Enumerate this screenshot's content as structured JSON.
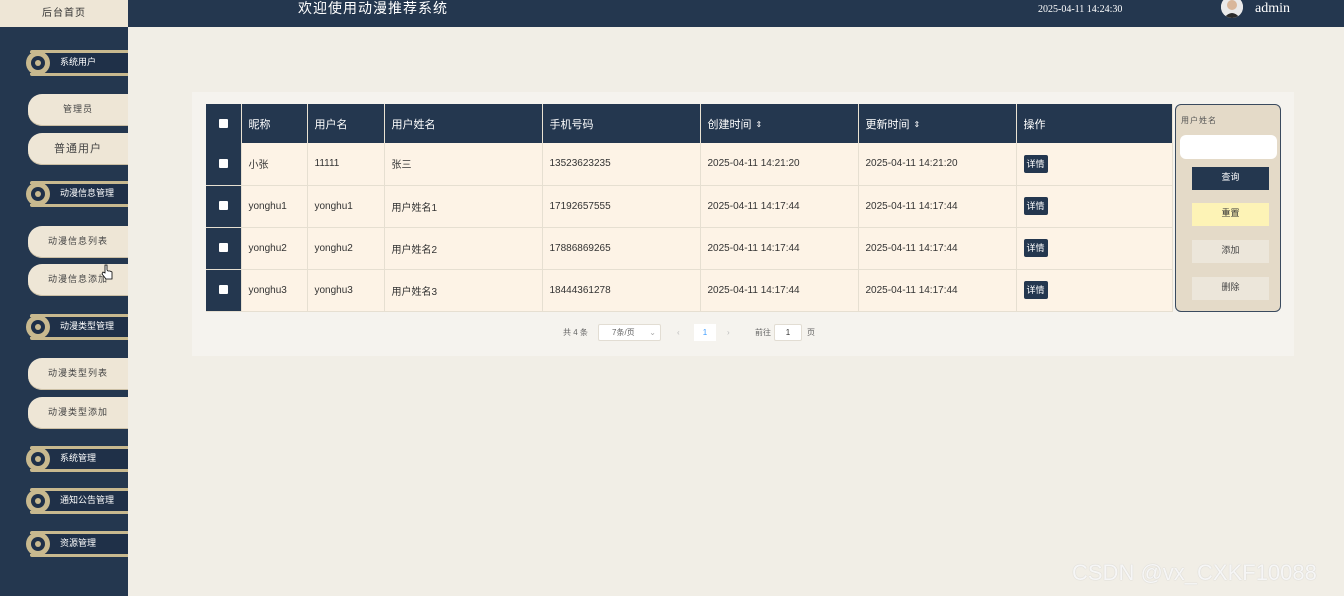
{
  "sidebar": {
    "home_label": "后台首页",
    "groups": [
      {
        "label": "系统用户"
      },
      {
        "label": "动漫信息管理"
      },
      {
        "label": "动漫类型管理"
      },
      {
        "label": "系统管理"
      },
      {
        "label": "通知公告管理"
      },
      {
        "label": "资源管理"
      }
    ],
    "items": [
      {
        "label": "管理员"
      },
      {
        "label": "普通用户"
      },
      {
        "label": "动漫信息列表"
      },
      {
        "label": "动漫信息添加"
      },
      {
        "label": "动漫类型列表"
      },
      {
        "label": "动漫类型添加"
      }
    ]
  },
  "header": {
    "title": "欢迎使用动漫推荐系统",
    "datetime": "2025-04-11 14:24:30",
    "username": "admin"
  },
  "table": {
    "columns": [
      "昵称",
      "用户名",
      "用户姓名",
      "手机号码",
      "创建时间",
      "更新时间",
      "操作"
    ],
    "detail_label": "详情",
    "rows": [
      {
        "nickname": "小张",
        "username": "11111",
        "realname": "张三",
        "phone": "13523623235",
        "created": "2025-04-11 14:21:20",
        "updated": "2025-04-11 14:21:20"
      },
      {
        "nickname": "yonghu1",
        "username": "yonghu1",
        "realname": "用户姓名1",
        "phone": "17192657555",
        "created": "2025-04-11 14:17:44",
        "updated": "2025-04-11 14:17:44"
      },
      {
        "nickname": "yonghu2",
        "username": "yonghu2",
        "realname": "用户姓名2",
        "phone": "17886869265",
        "created": "2025-04-11 14:17:44",
        "updated": "2025-04-11 14:17:44"
      },
      {
        "nickname": "yonghu3",
        "username": "yonghu3",
        "realname": "用户姓名3",
        "phone": "18444361278",
        "created": "2025-04-11 14:17:44",
        "updated": "2025-04-11 14:17:44"
      }
    ]
  },
  "pagination": {
    "total_text": "共 4 条",
    "page_size": "7条/页",
    "current_page": "1",
    "goto_label": "前往",
    "goto_value": "1",
    "page_unit": "页"
  },
  "search": {
    "label": "用户姓名",
    "query_label": "查询",
    "reset_label": "重置",
    "add_label": "添加",
    "delete_label": "删除"
  },
  "watermark": "CSDN @vx_CXKF10088",
  "colors": {
    "primary": "#24374f",
    "row_bg": "#fdf3e6",
    "page_bg": "#f1eee6",
    "reset_bg": "#fdf3b6",
    "accent_gold": "#c8b98f"
  }
}
